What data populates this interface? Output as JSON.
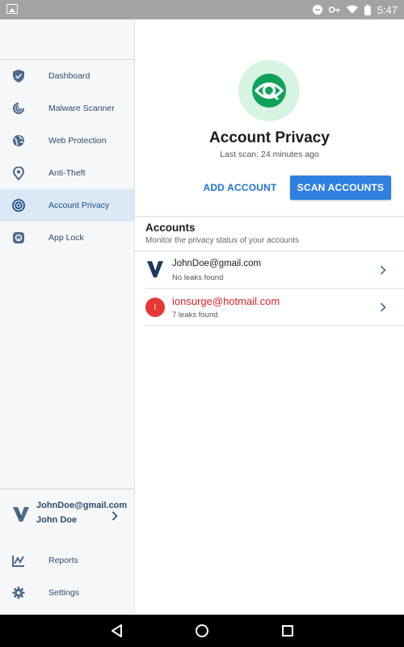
{
  "status_bar": {
    "time": "5:47"
  },
  "drawer": {
    "items": [
      {
        "label": "Dashboard",
        "icon": "shield-icon",
        "active": false
      },
      {
        "label": "Malware Scanner",
        "icon": "scanner-icon",
        "active": false
      },
      {
        "label": "Web Protection",
        "icon": "globe-icon",
        "active": false
      },
      {
        "label": "Anti-Theft",
        "icon": "location-pin-icon",
        "active": false
      },
      {
        "label": "Account Privacy",
        "icon": "eye-icon",
        "active": true
      },
      {
        "label": "App Lock",
        "icon": "lock-icon",
        "active": false
      }
    ],
    "account": {
      "email": "JohnDoe@gmail.com",
      "name": "John Doe"
    },
    "bottom_items": [
      {
        "label": "Reports",
        "icon": "reports-icon"
      },
      {
        "label": "Settings",
        "icon": "gear-icon"
      }
    ]
  },
  "main": {
    "title": "Account Privacy",
    "subtitle": "Last scan: 24 minutes ago",
    "add_button": "ADD ACCOUNT",
    "scan_button": "SCAN ACCOUNTS",
    "accounts_title": "Accounts",
    "accounts_subtitle": "Monitor the privacy status of your accounts",
    "accounts": [
      {
        "email": "JohnDoe@gmail.com",
        "status": "No leaks found",
        "avatar": "V"
      },
      {
        "email": "ionsurge@hotmail.com",
        "status": "7 leaks found",
        "avatar": "I"
      }
    ]
  },
  "colors": {
    "accent": "#2f80e0",
    "active_bg": "#dbe8f5",
    "brand_green": "#0fa25a",
    "leak_red": "#e02424"
  }
}
